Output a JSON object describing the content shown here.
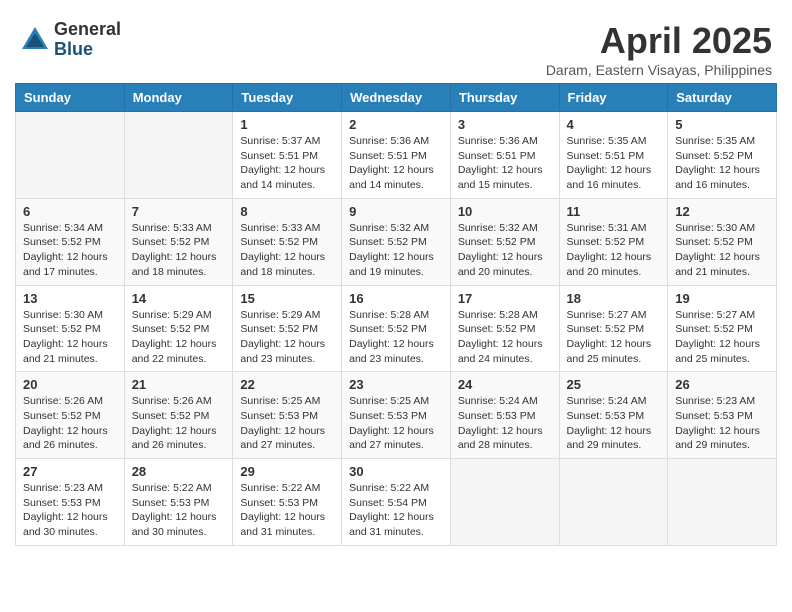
{
  "header": {
    "logo_general": "General",
    "logo_blue": "Blue",
    "month_title": "April 2025",
    "location": "Daram, Eastern Visayas, Philippines"
  },
  "weekdays": [
    "Sunday",
    "Monday",
    "Tuesday",
    "Wednesday",
    "Thursday",
    "Friday",
    "Saturday"
  ],
  "weeks": [
    [
      {
        "day": "",
        "info": ""
      },
      {
        "day": "",
        "info": ""
      },
      {
        "day": "1",
        "info": "Sunrise: 5:37 AM\nSunset: 5:51 PM\nDaylight: 12 hours\nand 14 minutes."
      },
      {
        "day": "2",
        "info": "Sunrise: 5:36 AM\nSunset: 5:51 PM\nDaylight: 12 hours\nand 14 minutes."
      },
      {
        "day": "3",
        "info": "Sunrise: 5:36 AM\nSunset: 5:51 PM\nDaylight: 12 hours\nand 15 minutes."
      },
      {
        "day": "4",
        "info": "Sunrise: 5:35 AM\nSunset: 5:51 PM\nDaylight: 12 hours\nand 16 minutes."
      },
      {
        "day": "5",
        "info": "Sunrise: 5:35 AM\nSunset: 5:52 PM\nDaylight: 12 hours\nand 16 minutes."
      }
    ],
    [
      {
        "day": "6",
        "info": "Sunrise: 5:34 AM\nSunset: 5:52 PM\nDaylight: 12 hours\nand 17 minutes."
      },
      {
        "day": "7",
        "info": "Sunrise: 5:33 AM\nSunset: 5:52 PM\nDaylight: 12 hours\nand 18 minutes."
      },
      {
        "day": "8",
        "info": "Sunrise: 5:33 AM\nSunset: 5:52 PM\nDaylight: 12 hours\nand 18 minutes."
      },
      {
        "day": "9",
        "info": "Sunrise: 5:32 AM\nSunset: 5:52 PM\nDaylight: 12 hours\nand 19 minutes."
      },
      {
        "day": "10",
        "info": "Sunrise: 5:32 AM\nSunset: 5:52 PM\nDaylight: 12 hours\nand 20 minutes."
      },
      {
        "day": "11",
        "info": "Sunrise: 5:31 AM\nSunset: 5:52 PM\nDaylight: 12 hours\nand 20 minutes."
      },
      {
        "day": "12",
        "info": "Sunrise: 5:30 AM\nSunset: 5:52 PM\nDaylight: 12 hours\nand 21 minutes."
      }
    ],
    [
      {
        "day": "13",
        "info": "Sunrise: 5:30 AM\nSunset: 5:52 PM\nDaylight: 12 hours\nand 21 minutes."
      },
      {
        "day": "14",
        "info": "Sunrise: 5:29 AM\nSunset: 5:52 PM\nDaylight: 12 hours\nand 22 minutes."
      },
      {
        "day": "15",
        "info": "Sunrise: 5:29 AM\nSunset: 5:52 PM\nDaylight: 12 hours\nand 23 minutes."
      },
      {
        "day": "16",
        "info": "Sunrise: 5:28 AM\nSunset: 5:52 PM\nDaylight: 12 hours\nand 23 minutes."
      },
      {
        "day": "17",
        "info": "Sunrise: 5:28 AM\nSunset: 5:52 PM\nDaylight: 12 hours\nand 24 minutes."
      },
      {
        "day": "18",
        "info": "Sunrise: 5:27 AM\nSunset: 5:52 PM\nDaylight: 12 hours\nand 25 minutes."
      },
      {
        "day": "19",
        "info": "Sunrise: 5:27 AM\nSunset: 5:52 PM\nDaylight: 12 hours\nand 25 minutes."
      }
    ],
    [
      {
        "day": "20",
        "info": "Sunrise: 5:26 AM\nSunset: 5:52 PM\nDaylight: 12 hours\nand 26 minutes."
      },
      {
        "day": "21",
        "info": "Sunrise: 5:26 AM\nSunset: 5:52 PM\nDaylight: 12 hours\nand 26 minutes."
      },
      {
        "day": "22",
        "info": "Sunrise: 5:25 AM\nSunset: 5:53 PM\nDaylight: 12 hours\nand 27 minutes."
      },
      {
        "day": "23",
        "info": "Sunrise: 5:25 AM\nSunset: 5:53 PM\nDaylight: 12 hours\nand 27 minutes."
      },
      {
        "day": "24",
        "info": "Sunrise: 5:24 AM\nSunset: 5:53 PM\nDaylight: 12 hours\nand 28 minutes."
      },
      {
        "day": "25",
        "info": "Sunrise: 5:24 AM\nSunset: 5:53 PM\nDaylight: 12 hours\nand 29 minutes."
      },
      {
        "day": "26",
        "info": "Sunrise: 5:23 AM\nSunset: 5:53 PM\nDaylight: 12 hours\nand 29 minutes."
      }
    ],
    [
      {
        "day": "27",
        "info": "Sunrise: 5:23 AM\nSunset: 5:53 PM\nDaylight: 12 hours\nand 30 minutes."
      },
      {
        "day": "28",
        "info": "Sunrise: 5:22 AM\nSunset: 5:53 PM\nDaylight: 12 hours\nand 30 minutes."
      },
      {
        "day": "29",
        "info": "Sunrise: 5:22 AM\nSunset: 5:53 PM\nDaylight: 12 hours\nand 31 minutes."
      },
      {
        "day": "30",
        "info": "Sunrise: 5:22 AM\nSunset: 5:54 PM\nDaylight: 12 hours\nand 31 minutes."
      },
      {
        "day": "",
        "info": ""
      },
      {
        "day": "",
        "info": ""
      },
      {
        "day": "",
        "info": ""
      }
    ]
  ]
}
